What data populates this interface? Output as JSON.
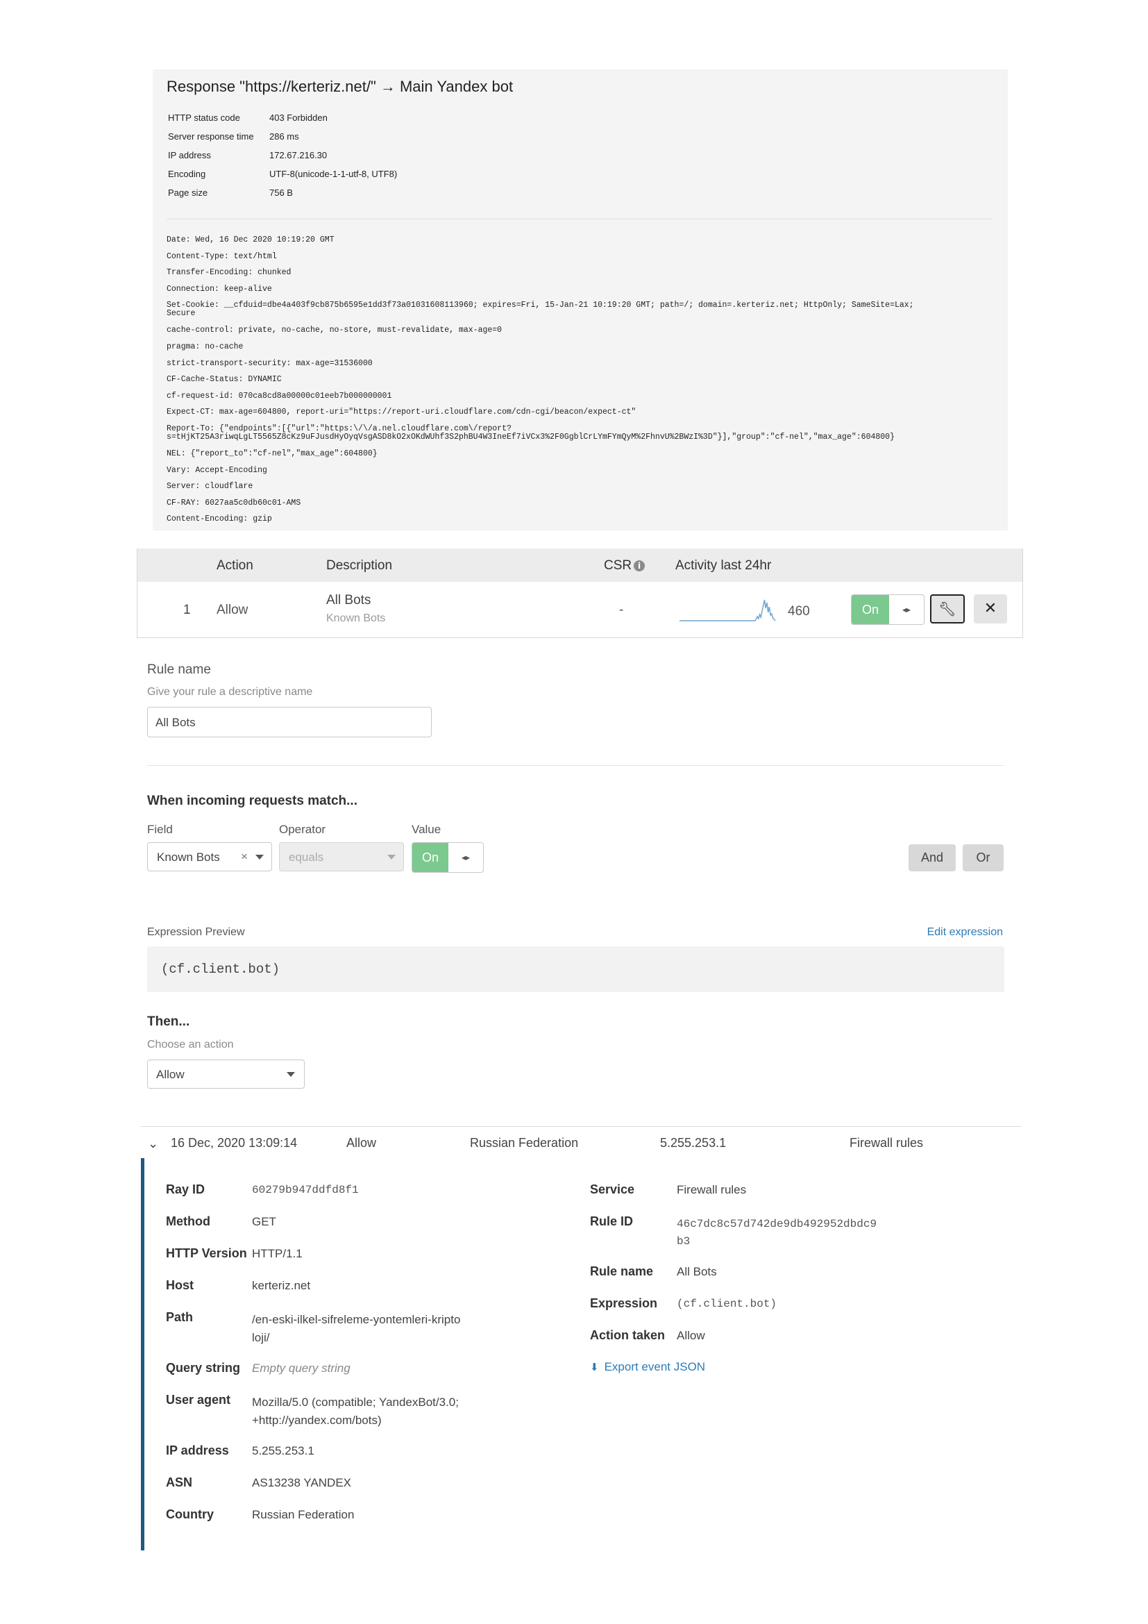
{
  "response": {
    "title": "Response \"https://kerteriz.net/\" → Main Yandex bot",
    "fields": [
      {
        "label": "HTTP status code",
        "value": "403 Forbidden"
      },
      {
        "label": "Server response time",
        "value": "286 ms"
      },
      {
        "label": "IP address",
        "value": "172.67.216.30"
      },
      {
        "label": "Encoding",
        "value": "UTF-8(unicode-1-1-utf-8, UTF8)"
      },
      {
        "label": "Page size",
        "value": "756 B"
      }
    ],
    "headers": [
      "Date: Wed, 16 Dec 2020 10:19:20 GMT",
      "Content-Type: text/html",
      "Transfer-Encoding: chunked",
      "Connection: keep-alive",
      "Set-Cookie: __cfduid=dbe4a403f9cb875b6595e1dd3f73a01031608113960; expires=Fri, 15-Jan-21 10:19:20 GMT; path=/; domain=.kerteriz.net; HttpOnly; SameSite=Lax;\nSecure",
      "cache-control: private, no-cache, no-store, must-revalidate, max-age=0",
      "pragma: no-cache",
      "strict-transport-security: max-age=31536000",
      "CF-Cache-Status: DYNAMIC",
      "cf-request-id: 070ca8cd8a00000c01eeb7b000000001",
      "Expect-CT: max-age=604800, report-uri=\"https://report-uri.cloudflare.com/cdn-cgi/beacon/expect-ct\"",
      "Report-To: {\"endpoints\":[{\"url\":\"https:\\/\\/a.nel.cloudflare.com\\/report?\ns=tHjKT25A3riwqLgLT5565Z8cKz9uFJusdHyOyqVsgASD8kO2xOKdWUhf3S2phBU4W3IneEf7iVCx3%2F0GgblCrLYmFYmQyM%2FhnvU%2BWzI%3D\"}],\"group\":\"cf-nel\",\"max_age\":604800}",
      "NEL: {\"report_to\":\"cf-nel\",\"max_age\":604800}",
      "Vary: Accept-Encoding",
      "Server: cloudflare",
      "CF-RAY: 6027aa5c0db60c01-AMS",
      "Content-Encoding: gzip"
    ]
  },
  "rules_table": {
    "columns": {
      "action": "Action",
      "description": "Description",
      "csr": "CSR",
      "activity": "Activity last 24hr"
    },
    "row": {
      "index": "1",
      "action": "Allow",
      "description": "All Bots",
      "sub_description": "Known Bots",
      "csr": "-",
      "activity_count": "460",
      "toggle_label": "On"
    },
    "sparkline": [
      0,
      0,
      0,
      0,
      0,
      0,
      0,
      0,
      0,
      0,
      0,
      0,
      0,
      0,
      0,
      0,
      0,
      0,
      0,
      0,
      0,
      0,
      0,
      0,
      0,
      0,
      0,
      0,
      0,
      0,
      0,
      0,
      0,
      0,
      0,
      0,
      0,
      0,
      0,
      0,
      0,
      0,
      0,
      0,
      0,
      0,
      0,
      0,
      0,
      0,
      0,
      0,
      0,
      0,
      0,
      0,
      0,
      0,
      0,
      0,
      0,
      0,
      0,
      0,
      2,
      6,
      3,
      9,
      5,
      14,
      22,
      30,
      18,
      26,
      12,
      20,
      8,
      10,
      4,
      2,
      0
    ],
    "icons": {
      "toggle": "arrows-horizontal-icon",
      "edit": "wrench-icon",
      "delete": "close-icon"
    },
    "colors": {
      "on": "#7cc98f"
    }
  },
  "rule_form": {
    "rule_name_label": "Rule name",
    "rule_name_hint": "Give your rule a descriptive name",
    "rule_name_value": "All Bots",
    "match_heading": "When incoming requests match...",
    "field_label": "Field",
    "operator_label": "Operator",
    "value_label": "Value",
    "field_value": "Known Bots",
    "field_clear": "×",
    "operator_value": "equals",
    "value_toggle": "On",
    "and_label": "And",
    "or_label": "Or",
    "expression_preview_label": "Expression Preview",
    "edit_expression_label": "Edit expression",
    "expression": "(cf.client.bot)",
    "then_heading": "Then...",
    "action_hint": "Choose an action",
    "action_value": "Allow"
  },
  "event": {
    "summary": {
      "datetime": "16 Dec, 2020 13:09:14",
      "action": "Allow",
      "country": "Russian Federation",
      "ip": "5.255.253.1",
      "service": "Firewall rules"
    },
    "left": [
      {
        "key": "Ray ID",
        "value": "60279b947ddfd8f1"
      },
      {
        "key": "Method",
        "value": "GET"
      },
      {
        "key": "HTTP Version",
        "value": "HTTP/1.1"
      },
      {
        "key": "Host",
        "value": "kerteriz.net"
      },
      {
        "key": "Path",
        "value": "/en-eski-ilkel-sifreleme-yontemleri-kripto\nloji/"
      },
      {
        "key": "Query string",
        "value": "Empty query string"
      },
      {
        "key": "User agent",
        "value": "Mozilla/5.0 (compatible; YandexBot/3.0;\n+http://yandex.com/bots)"
      },
      {
        "key": "IP address",
        "value": "5.255.253.1"
      },
      {
        "key": "ASN",
        "value": "AS13238 YANDEX"
      },
      {
        "key": "Country",
        "value": "Russian Federation"
      }
    ],
    "right": [
      {
        "key": "Service",
        "value": "Firewall rules"
      },
      {
        "key": "Rule ID",
        "value": "46c7dc8c57d742de9db492952dbdc9\nb3"
      },
      {
        "key": "Rule name",
        "value": "All Bots"
      },
      {
        "key": "Expression",
        "value": "(cf.client.bot)"
      },
      {
        "key": "Action taken",
        "value": "Allow"
      }
    ],
    "export_label": "Export event JSON",
    "colors": {
      "accent_bar": "#1f5a80",
      "link": "#2c7cb7"
    }
  }
}
